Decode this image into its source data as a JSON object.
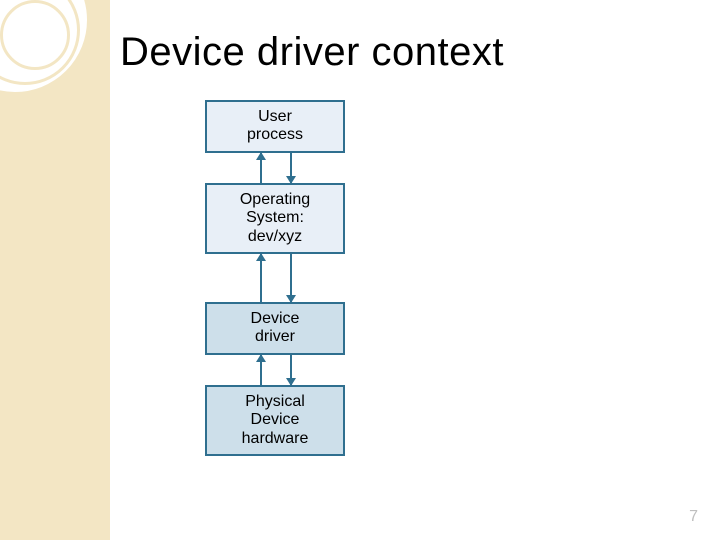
{
  "title": "Device driver context",
  "boxes": [
    {
      "id": "user-process",
      "label": "User\nprocess",
      "style": "light"
    },
    {
      "id": "operating-system",
      "label": "Operating\nSystem:\ndev/xyz",
      "style": "light"
    },
    {
      "id": "device-driver",
      "label": "Device\ndriver",
      "style": "dark"
    },
    {
      "id": "physical-device",
      "label": "Physical\nDevice\nhardware",
      "style": "dark"
    }
  ],
  "connectors": [
    {
      "from": "user-process",
      "to": "operating-system",
      "bidirectional": true
    },
    {
      "from": "operating-system",
      "to": "device-driver",
      "bidirectional": true
    },
    {
      "from": "device-driver",
      "to": "physical-device",
      "bidirectional": true
    }
  ],
  "page_number": "7",
  "colors": {
    "accent": "#2f6f8f",
    "band": "#f3e6c4"
  }
}
